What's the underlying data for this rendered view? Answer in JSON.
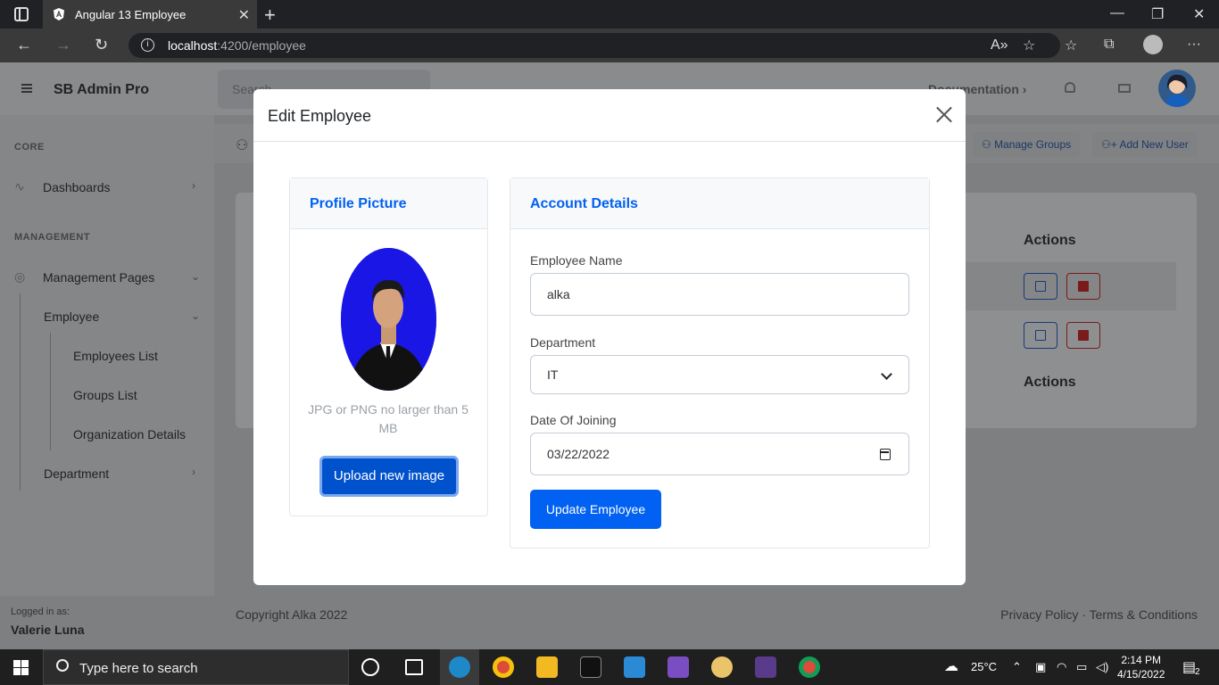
{
  "browser": {
    "tab_title": "Angular 13 Employee",
    "url_host": "localhost",
    "url_path": ":4200/employee"
  },
  "app": {
    "brand": "SB Admin Pro",
    "search_placeholder": "Search",
    "documentation": "Documentation",
    "sidebar": {
      "core_heading": "CORE",
      "dashboards": "Dashboards",
      "management_heading": "MANAGEMENT",
      "management_pages": "Management Pages",
      "employee": "Employee",
      "employees_list": "Employees List",
      "groups_list": "Groups List",
      "organization_details": "Organization Details",
      "department": "Department",
      "logged_in_as": "Logged in as:",
      "user_name": "Valerie Luna"
    },
    "page": {
      "manage_groups": "Manage Groups",
      "add_new_user": "Add New User",
      "actions_header": "Actions",
      "actions_footer": "Actions"
    },
    "footer": {
      "copyright": "Copyright Alka 2022",
      "links": "Privacy Policy · Terms & Conditions"
    }
  },
  "modal": {
    "title": "Edit Employee",
    "profile_card": {
      "title": "Profile Picture",
      "hint": "JPG or PNG no larger than 5 MB",
      "upload_label": "Upload new image"
    },
    "account_card": {
      "title": "Account Details",
      "name_label": "Employee Name",
      "name_value": "alka",
      "department_label": "Department",
      "department_value": "IT",
      "doj_label": "Date Of Joining",
      "doj_value": "03/22/2022",
      "update_label": "Update Employee"
    }
  },
  "taskbar": {
    "search_text": "Type here to search",
    "temperature": "25°C",
    "time": "2:14 PM",
    "date": "4/15/2022",
    "notification_count": "2"
  }
}
